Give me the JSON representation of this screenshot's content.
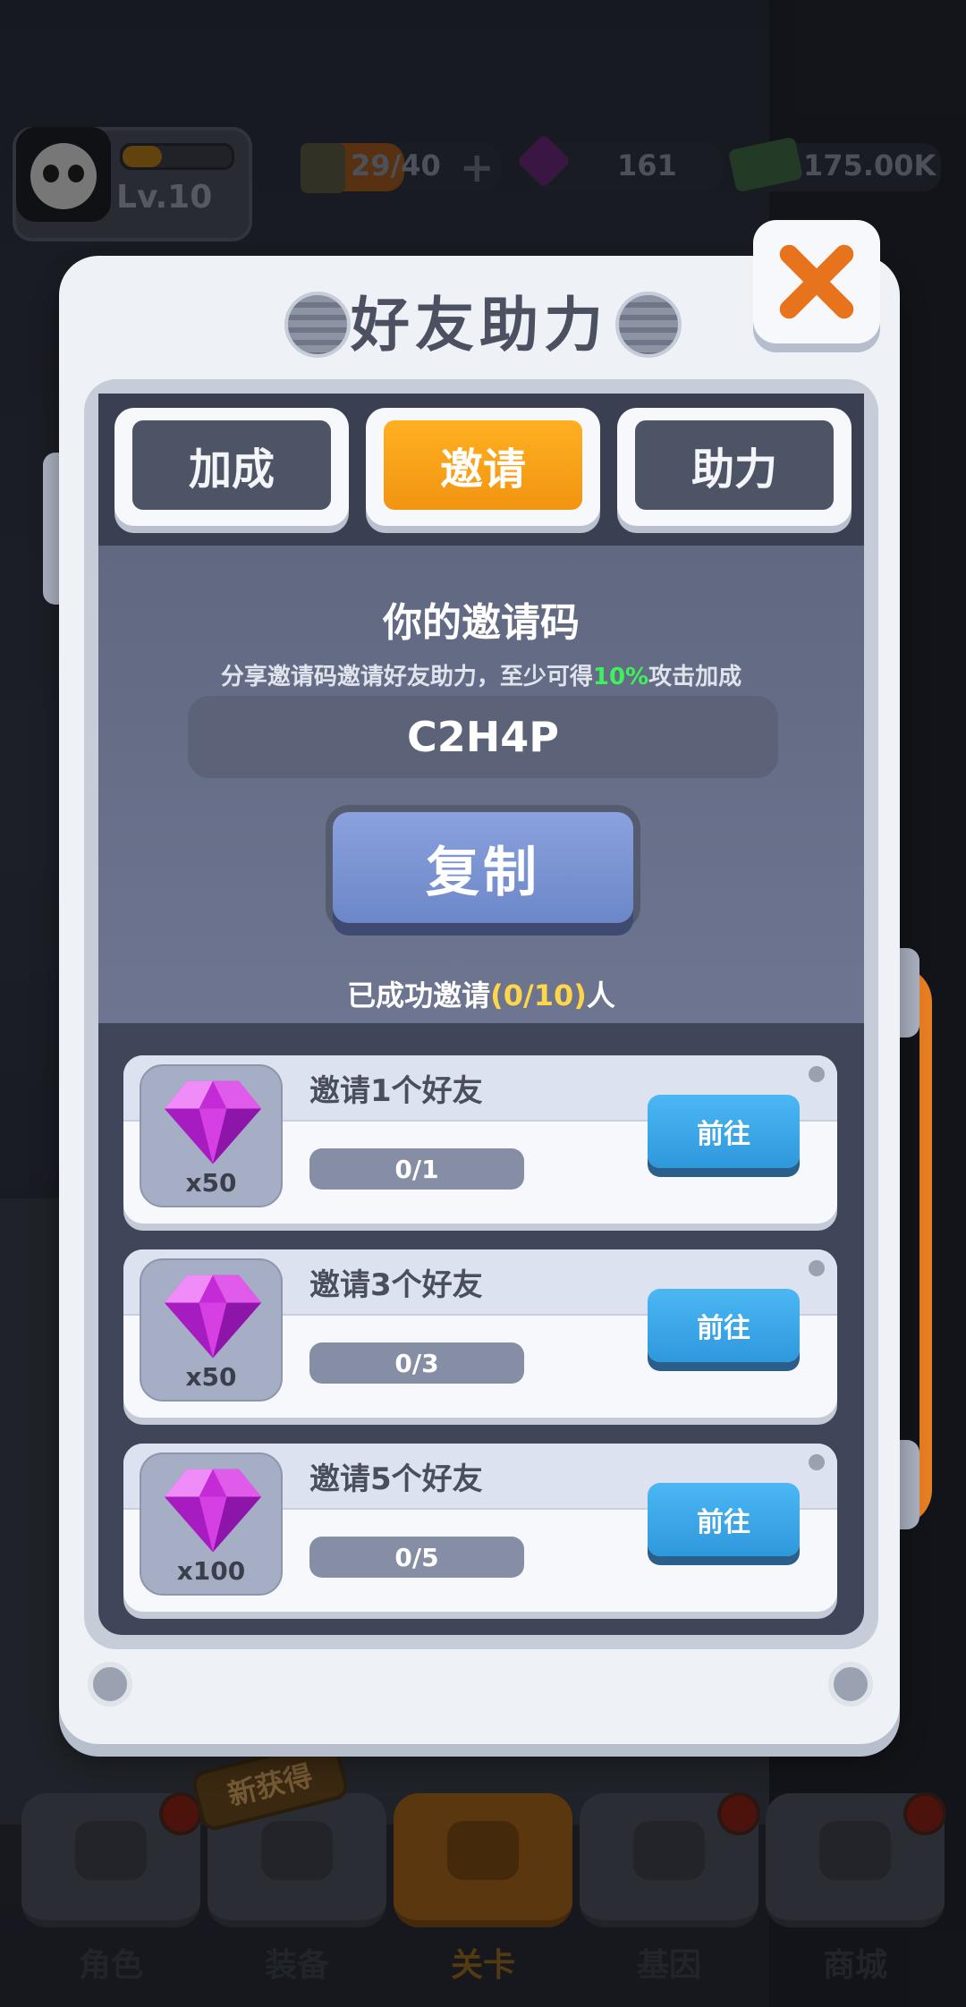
{
  "hud": {
    "level": "Lv.10",
    "energy": "29/40",
    "gems": "161",
    "cash": "175.00K",
    "xp_fraction": 0.35
  },
  "popup": {
    "title": "好友助力",
    "tabs": [
      {
        "label": "加成",
        "active": false
      },
      {
        "label": "邀请",
        "active": true
      },
      {
        "label": "助力",
        "active": false
      }
    ],
    "invite_title": "你的邀请码",
    "desc_before": "分享邀请码邀请好友助力，至少可得",
    "desc_highlight": "10%",
    "desc_after": "攻击加成",
    "code": "C2H4P",
    "copy_label": "复制",
    "invited_before": "已成功邀请",
    "invited_count": "(0/10)",
    "invited_after": "人",
    "rewards": [
      {
        "title": "邀请1个好友",
        "qty": "x50",
        "progress": "0/1",
        "button": "前往",
        "icon": "gem-icon"
      },
      {
        "title": "邀请3个好友",
        "qty": "x50",
        "progress": "0/3",
        "button": "前往",
        "icon": "gem-icon"
      },
      {
        "title": "邀请5个好友",
        "qty": "x100",
        "progress": "0/5",
        "button": "前往",
        "icon": "gem-icon"
      }
    ]
  },
  "nav": {
    "items": [
      {
        "label": "角色"
      },
      {
        "label": "装备"
      },
      {
        "label": "关卡"
      },
      {
        "label": "基因"
      },
      {
        "label": "商城"
      }
    ],
    "new_badge": "新获得"
  },
  "colors": {
    "accent_orange": "#f29411",
    "highlight_green": "#3df15a",
    "highlight_yellow": "#ffd54a",
    "button_blue": "#2e98dc"
  }
}
